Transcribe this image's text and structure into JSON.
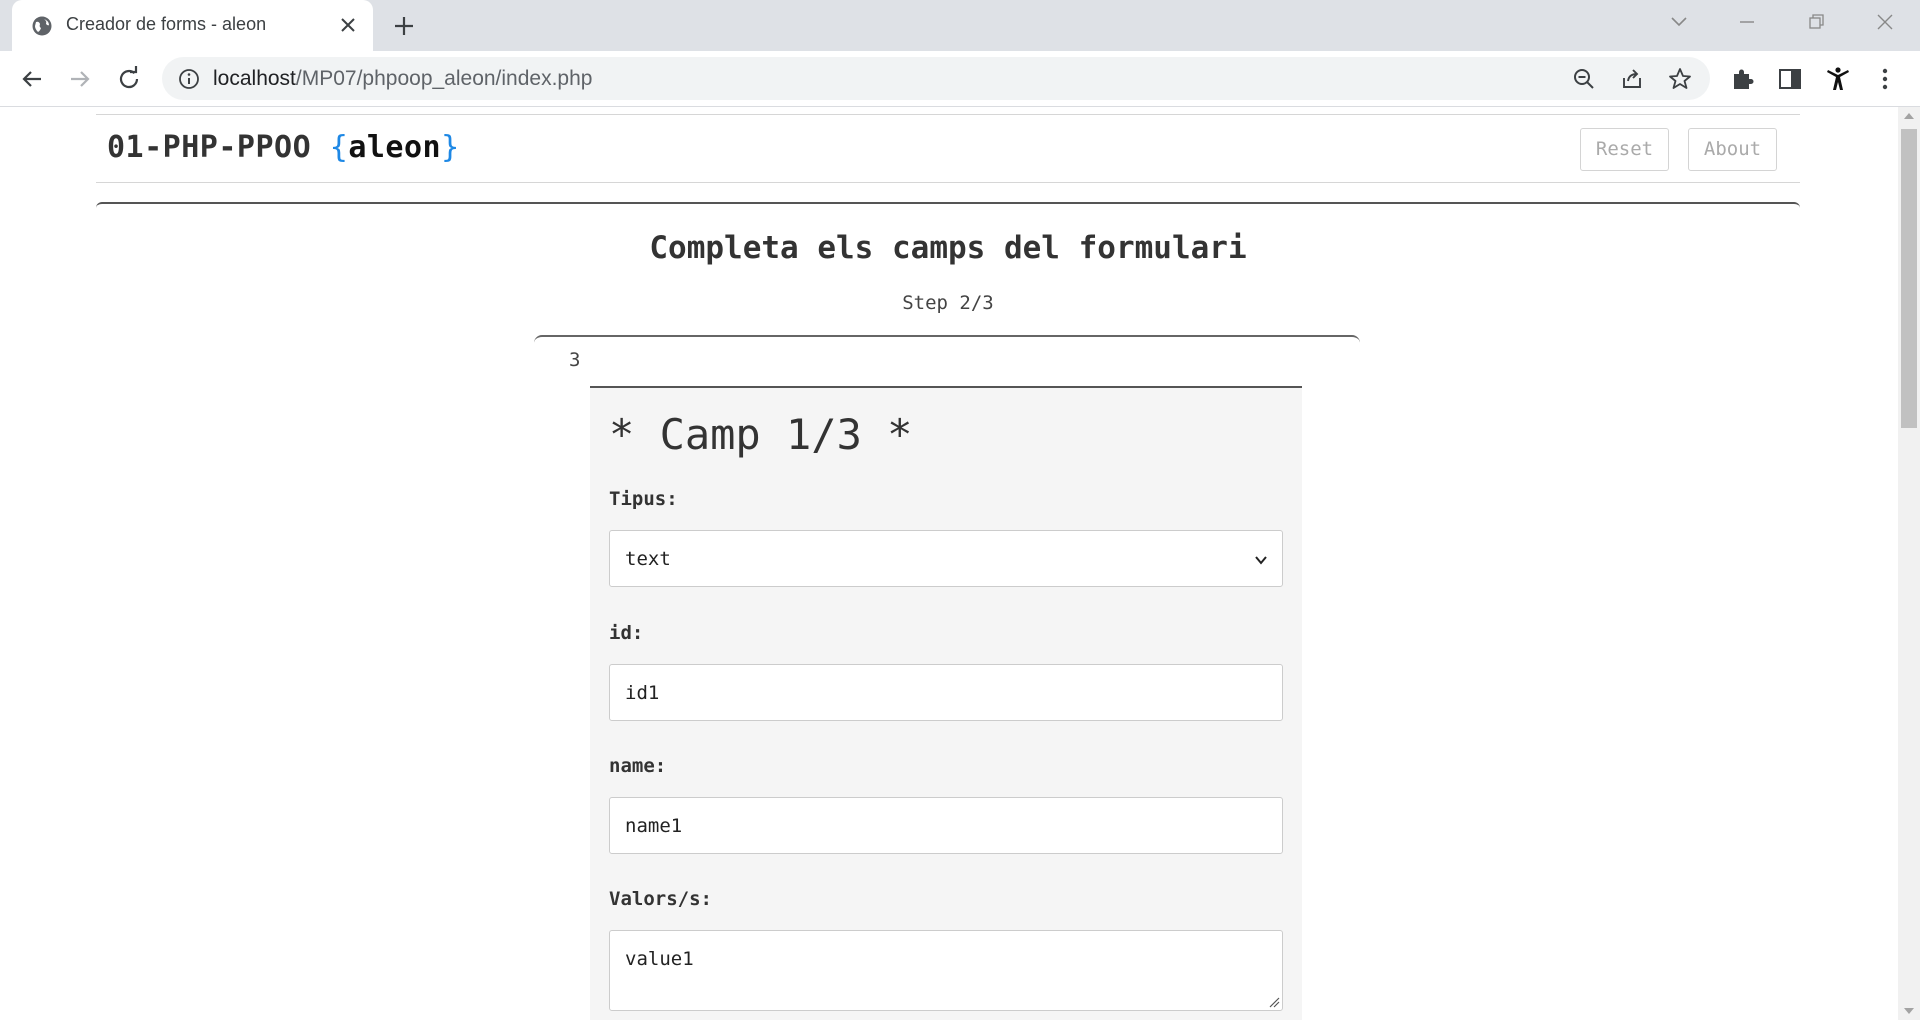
{
  "browser": {
    "tab_title": "Creador de forms - aleon",
    "url_host": "localhost",
    "url_path": "/MP07/phpoop_aleon/index.php"
  },
  "site": {
    "brand_prefix": "01-PHP-PPOO ",
    "brand_open": "{",
    "brand_name": "aleon",
    "brand_close": "}",
    "reset_label": "Reset",
    "about_label": "About",
    "accent_color": "#1e88e5"
  },
  "page": {
    "title": "Completa els camps del formulari",
    "step": "Step 2/3",
    "count": "3"
  },
  "field": {
    "title": "* Camp 1/3 *",
    "type_label": "Tipus:",
    "type_value": "text",
    "id_label": "id:",
    "id_value": "id1",
    "name_label": "name:",
    "name_value": "name1",
    "values_label": "Valors/s:",
    "values_value": "value1"
  }
}
